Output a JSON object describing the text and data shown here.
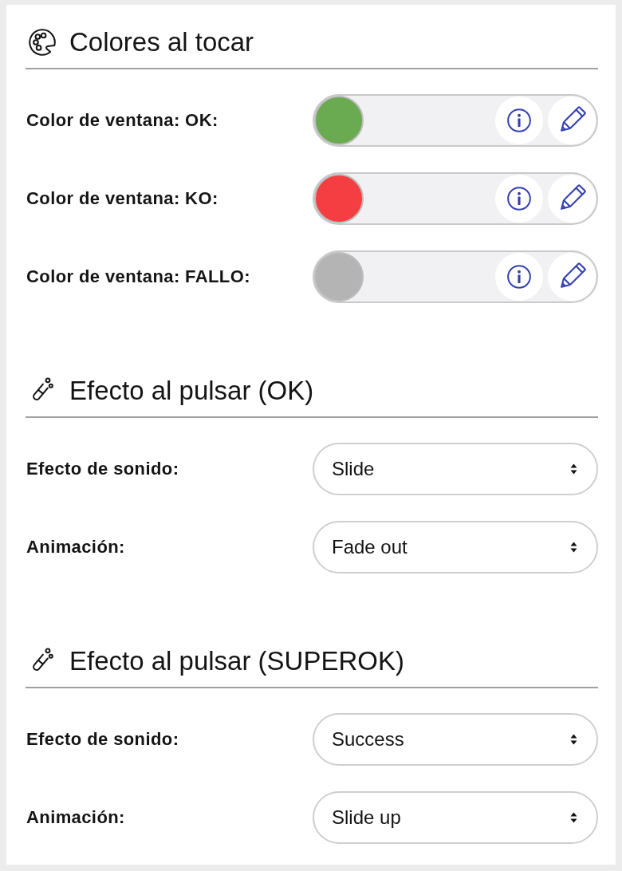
{
  "sections": [
    {
      "kind": "colors",
      "title": "Colores al tocar",
      "rows": [
        {
          "kind": "color",
          "label": "Color de ventana: OK:",
          "color": "#6aaa50"
        },
        {
          "kind": "color",
          "label": "Color de ventana: KO:",
          "color": "#f43e41"
        },
        {
          "kind": "color",
          "label": "Color de ventana: FALLO:",
          "color": "#b4b4b4"
        }
      ]
    },
    {
      "kind": "effects",
      "title": "Efecto al pulsar (OK)",
      "rows": [
        {
          "kind": "select",
          "label": "Efecto de sonido:",
          "value": "Slide"
        },
        {
          "kind": "select",
          "label": "Animación:",
          "value": "Fade out"
        }
      ]
    },
    {
      "kind": "effects",
      "title": "Efecto al pulsar (SUPEROK)",
      "rows": [
        {
          "kind": "select",
          "label": "Efecto de sonido:",
          "value": "Success"
        },
        {
          "kind": "select",
          "label": "Animación:",
          "value": "Slide up"
        }
      ]
    }
  ]
}
